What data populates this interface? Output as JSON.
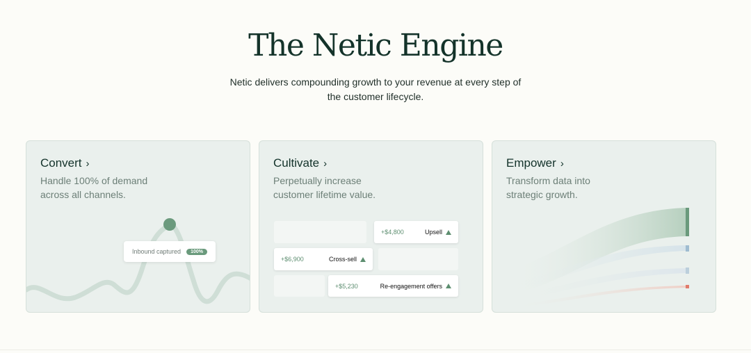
{
  "hero": {
    "title": "The Netic Engine",
    "subtitle_line1": "Netic delivers compounding growth to your revenue at every step of",
    "subtitle_line2": "the customer lifecycle."
  },
  "cards": [
    {
      "title": "Convert",
      "desc_line1": "Handle 100% of demand",
      "desc_line2": "across all channels.",
      "tag_label": "Inbound captured",
      "tag_pill": "100%"
    },
    {
      "title": "Cultivate",
      "desc_line1": "Perpetually increase",
      "desc_line2": "customer lifetime value.",
      "offers": [
        {
          "amount": "+$4,800",
          "label": "Upsell"
        },
        {
          "amount": "+$6,900",
          "label": "Cross-sell"
        },
        {
          "amount": "+$5,230",
          "label": "Re-engagement offers"
        }
      ]
    },
    {
      "title": "Empower",
      "desc_line1": "Transform data into",
      "desc_line2": "strategic growth."
    }
  ],
  "icons": {
    "chevron": "chevron-right-icon",
    "trend": "triangle-up-icon"
  },
  "colors": {
    "accent_green": "#5d8e70",
    "card_bg": "#eaf0ed",
    "page_bg": "#fcfcf8",
    "title_text": "#14332a"
  }
}
